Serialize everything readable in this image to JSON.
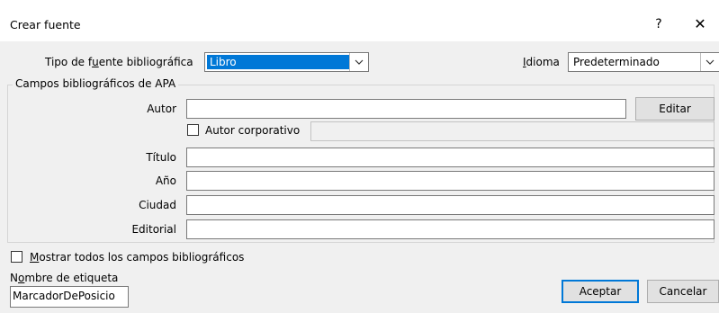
{
  "dialog": {
    "title": "Crear fuente",
    "help_label": "?",
    "close_label": "✕"
  },
  "source_type": {
    "label_pre": "Tipo de f",
    "label_access": "u",
    "label_post": "ente bibliográfica",
    "value": "Libro"
  },
  "language": {
    "label_access": "I",
    "label_post": "dioma",
    "value": "Predeterminado"
  },
  "group": {
    "title": "Campos bibliográficos de APA"
  },
  "fields": {
    "autor_label": "Autor",
    "autor_value": "",
    "edit_label": "Editar",
    "corporate_label": "Autor corporativo",
    "corporate_value": "",
    "titulo_label": "Título",
    "titulo_value": "",
    "anio_label": "Año",
    "anio_value": "",
    "ciudad_label": "Ciudad",
    "ciudad_value": "",
    "editorial_label": "Editorial",
    "editorial_value": ""
  },
  "show_all": {
    "label_access": "M",
    "label_post": "ostrar todos los campos bibliográficos",
    "checked": false
  },
  "tag": {
    "label_pre": "N",
    "label_access": "o",
    "label_post": "mbre de etiqueta",
    "value": "MarcadorDePosicio"
  },
  "buttons": {
    "accept_label": "Aceptar",
    "cancel_label": "Cancelar"
  },
  "colors": {
    "selection": "#0078d7",
    "dialog_bg": "#f0f0f0",
    "titlebar_bg": "#ffffff"
  }
}
